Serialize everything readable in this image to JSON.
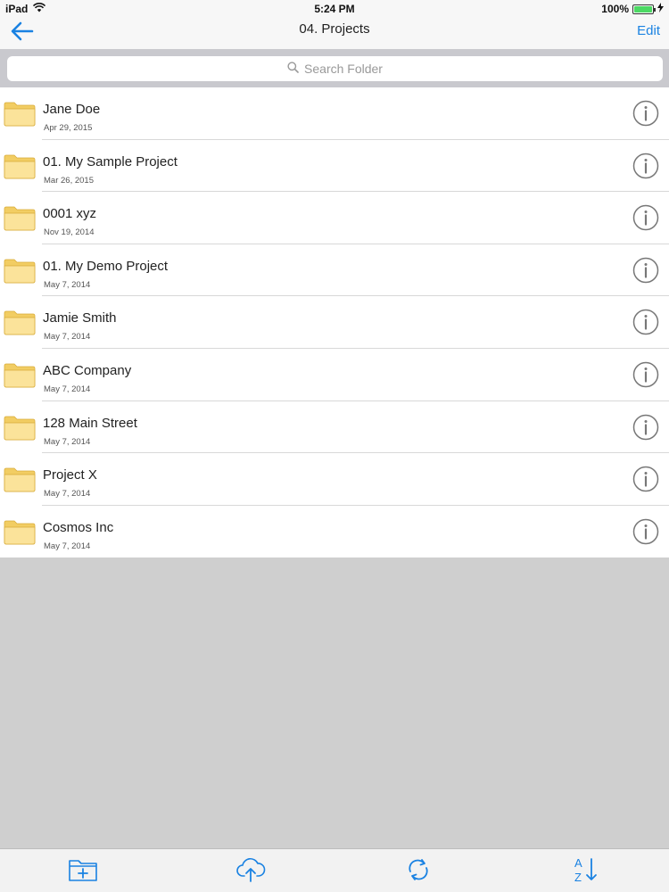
{
  "status_bar": {
    "device": "iPad",
    "time": "5:24 PM",
    "battery": "100%",
    "battery_level": 1.0
  },
  "nav": {
    "back_icon": "arrow-left-icon",
    "title": "04. Projects",
    "edit_label": "Edit"
  },
  "search": {
    "placeholder": "Search Folder",
    "icon": "search-icon"
  },
  "folders": [
    {
      "name": "Jane Doe",
      "date": "Apr 29, 2015"
    },
    {
      "name": "01. My Sample Project",
      "date": "Mar 26, 2015"
    },
    {
      "name": "0001 xyz",
      "date": "Nov 19, 2014"
    },
    {
      "name": "01. My Demo Project",
      "date": "May 7, 2014"
    },
    {
      "name": "Jamie Smith",
      "date": "May 7, 2014"
    },
    {
      "name": "ABC Company",
      "date": "May 7, 2014"
    },
    {
      "name": "128 Main Street",
      "date": "May 7, 2014"
    },
    {
      "name": "Project X",
      "date": "May 7, 2014"
    },
    {
      "name": "Cosmos Inc",
      "date": "May 7, 2014"
    }
  ],
  "toolbar": {
    "icons": [
      "new-folder-icon",
      "cloud-upload-icon",
      "sync-icon",
      "sort-az-icon"
    ]
  },
  "colors": {
    "accent": "#1a82e2",
    "folder": "#f7d77a"
  }
}
